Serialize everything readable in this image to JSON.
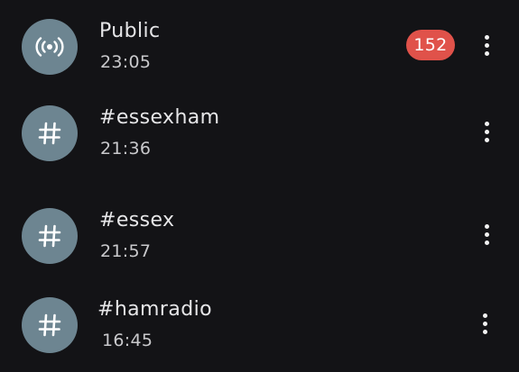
{
  "channels": [
    {
      "name": "Public",
      "time": "23:05",
      "icon": "broadcast-icon",
      "unread": "152"
    },
    {
      "name": "#essexham",
      "time": "21:36",
      "icon": "hashtag-icon"
    },
    {
      "name": "#essex",
      "time": "21:57",
      "icon": "hashtag-icon"
    },
    {
      "name": "#hamradio",
      "time": "16:45",
      "icon": "hashtag-icon"
    }
  ],
  "colors": {
    "background": "#131316",
    "avatar": "#6d8591",
    "badge": "#e0524a"
  }
}
